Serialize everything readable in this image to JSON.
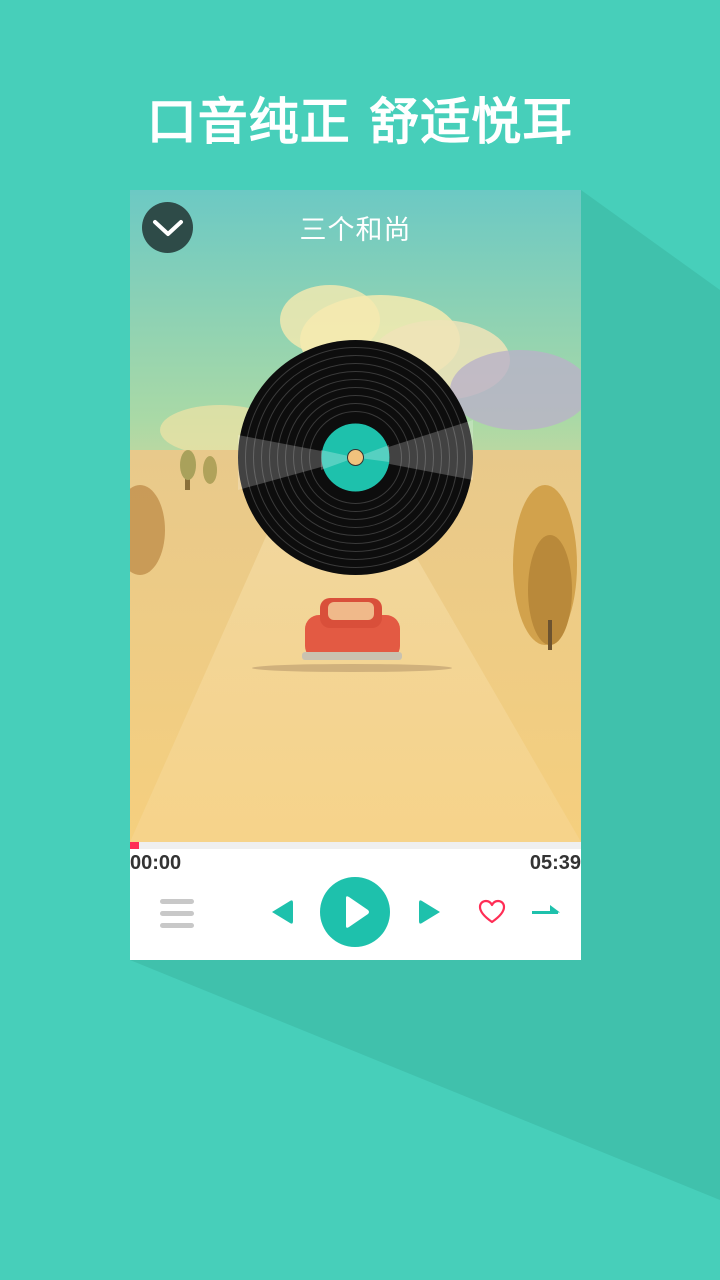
{
  "headline": "口音纯正 舒适悦耳",
  "player": {
    "song_title": "三个和尚",
    "time_current": "00:00",
    "time_total": "05:39",
    "progress": 0.02
  },
  "icons": {
    "collapse": "chevron-down-icon",
    "playlist": "menu-list-icon",
    "prev": "previous-icon",
    "play": "play-icon",
    "next": "next-icon",
    "like": "heart-icon",
    "mode": "play-mode-icon"
  },
  "colors": {
    "background": "#47cfba",
    "accent": "#1ec1ac",
    "progress": "#ff2d55",
    "like": "#ff2d55"
  }
}
